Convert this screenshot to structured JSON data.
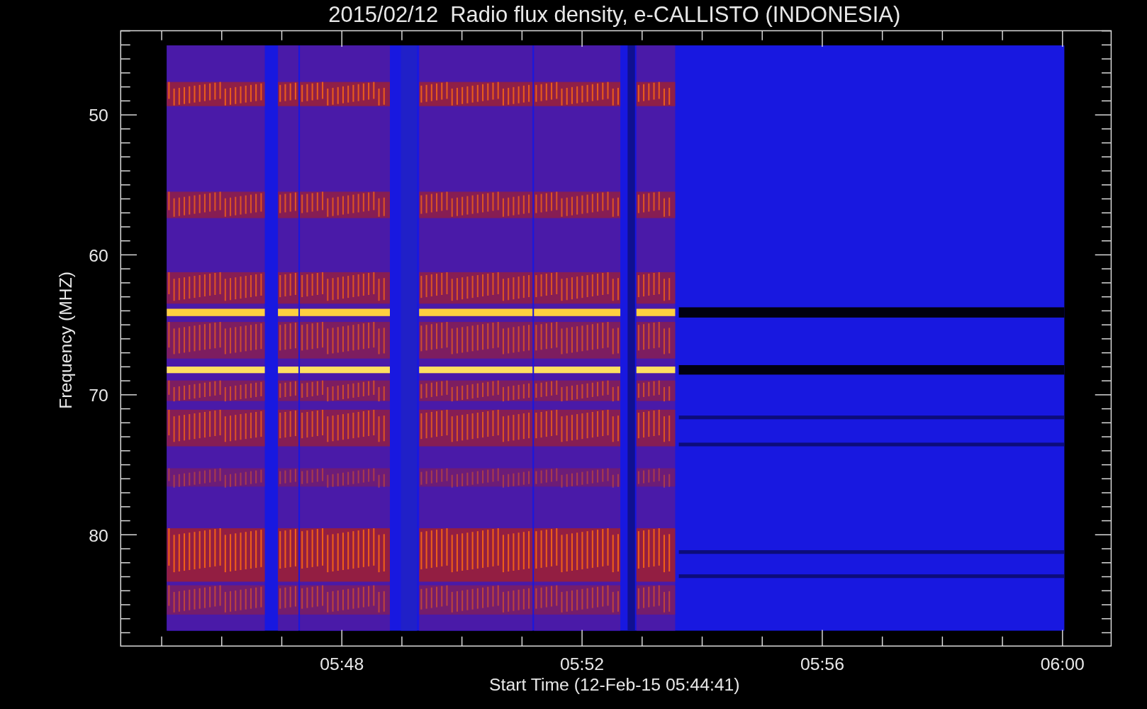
{
  "title": "2015/02/12  Radio flux density, e-CALLISTO (INDONESIA)",
  "y_axis": {
    "label": "Frequency (MHZ)",
    "ticks": [
      "50",
      "60",
      "70",
      "80"
    ]
  },
  "x_axis": {
    "label": "Start Time (12-Feb-15 05:44:41)",
    "ticks": [
      "05:48",
      "05:52",
      "05:56",
      "06:00"
    ]
  }
}
